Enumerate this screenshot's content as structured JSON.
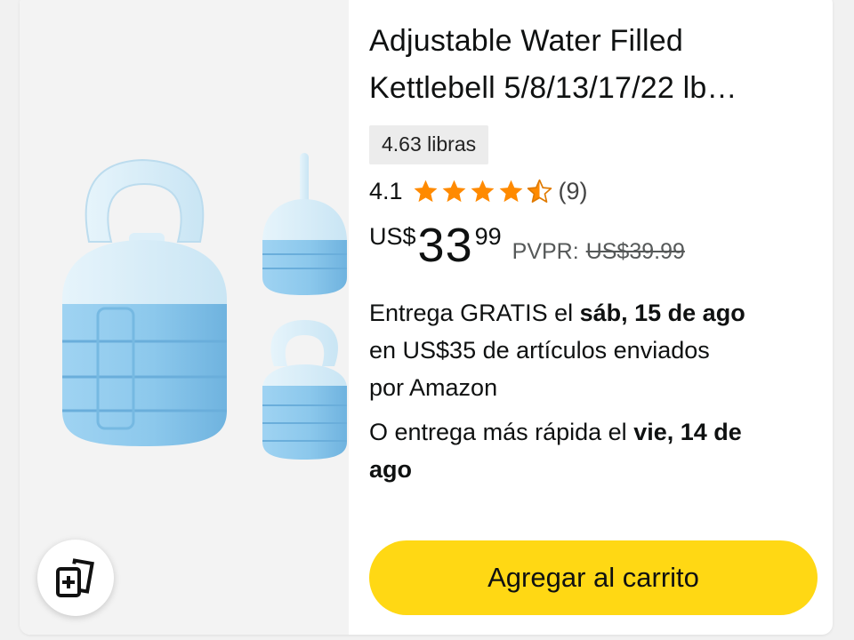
{
  "product": {
    "title_line1": "Adjustable Water Filled",
    "title_line2": "Kettlebell 5/8/13/17/22 lb…",
    "weight": "4.63 libras",
    "rating": {
      "value": "4.1",
      "stars_out_of_5": 4.5,
      "count": "(9)"
    },
    "price": {
      "currency": "US$",
      "whole": "33",
      "fraction": "99",
      "list_label": "PVPR:",
      "list_price": "US$39.99"
    },
    "delivery": {
      "prefix": "Entrega GRATIS el",
      "date": "sáb, 15 de ago",
      "line2": "en US$35 de artículos enviados",
      "line3": "por Amazon"
    },
    "fast_delivery": {
      "prefix": "O entrega más rápida el",
      "date_part1": "vie, 14 de",
      "date_part2": "ago"
    }
  },
  "actions": {
    "add_to_cart_label": "Agregar al carrito",
    "compare_icon": "compare-cards-icon"
  },
  "colors": {
    "star": "#ff8a00",
    "cart_button": "#ffd814",
    "kettlebell_light": "#d6ecf7",
    "kettlebell_blue": "#8fcbee"
  }
}
